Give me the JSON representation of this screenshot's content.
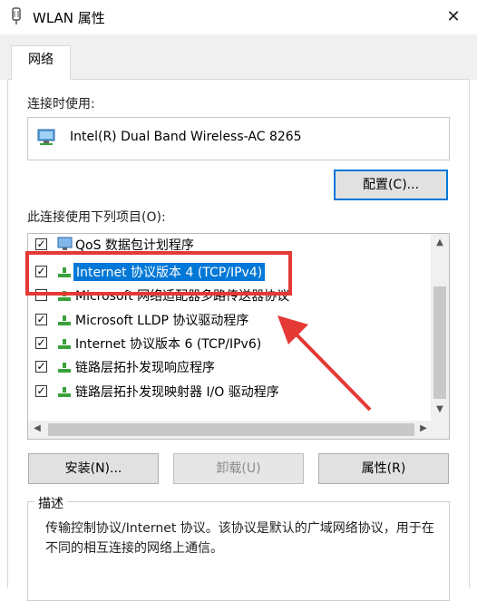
{
  "window": {
    "title": "WLAN 属性",
    "close_glyph": "✕"
  },
  "tabs": [
    {
      "label": "网络"
    }
  ],
  "connect_using": {
    "label": "连接时使用:",
    "adapter_name": "Intel(R) Dual Band Wireless-AC 8265",
    "configure_label": "配置(C)..."
  },
  "components": {
    "label": "此连接使用下列项目(O):",
    "items": [
      {
        "label": "QoS 数据包计划程序",
        "checked": true,
        "icon": "qos-icon"
      },
      {
        "label": "Internet 协议版本 4 (TCP/IPv4)",
        "checked": true,
        "selected": true,
        "icon": "network-protocol-icon"
      },
      {
        "label": "Microsoft 网络适配器多路传送器协议",
        "checked": false,
        "icon": "network-protocol-icon"
      },
      {
        "label": "Microsoft LLDP 协议驱动程序",
        "checked": true,
        "icon": "network-protocol-icon"
      },
      {
        "label": "Internet 协议版本 6 (TCP/IPv6)",
        "checked": true,
        "icon": "network-protocol-icon"
      },
      {
        "label": "链路层拓扑发现响应程序",
        "checked": true,
        "icon": "network-protocol-icon"
      },
      {
        "label": "链路层拓扑发现映射器 I/O 驱动程序",
        "checked": true,
        "icon": "network-protocol-icon"
      }
    ]
  },
  "buttons": {
    "install": "安装(N)...",
    "uninstall": "卸载(U)",
    "properties": "属性(R)"
  },
  "description": {
    "title": "描述",
    "text": "传输控制协议/Internet 协议。该协议是默认的广域网络协议，用于在不同的相互连接的网络上通信。"
  },
  "colors": {
    "accent": "#0078d7",
    "annotation": "#e53935",
    "protocol_icon": "#3aa23a"
  }
}
